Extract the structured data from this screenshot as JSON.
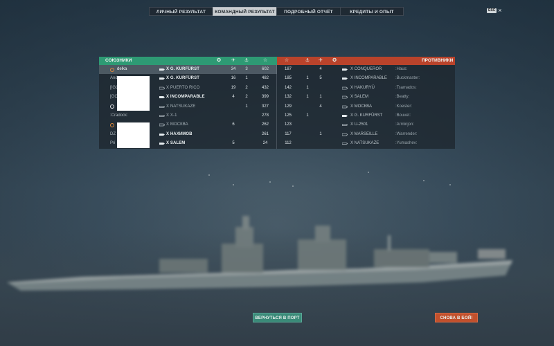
{
  "tabs": [
    {
      "label": "ЛИЧНЫЙ РЕЗУЛЬТАТ",
      "active": false
    },
    {
      "label": "КОМАНДНЫЙ РЕЗУЛЬТАТ",
      "active": true
    },
    {
      "label": "ПОДРОБНЫЙ ОТЧЁТ",
      "active": false
    },
    {
      "label": "КРЕДИТЫ И ОПЫТ",
      "active": false
    }
  ],
  "esc": {
    "key": "ESC",
    "close": "×"
  },
  "allies": {
    "title": "СОЮЗНИКИ",
    "color": "#2e9a74",
    "column_icons": [
      "laurel-icon",
      "planes-icon",
      "ship-kill-icon",
      "star-icon"
    ],
    "rows": [
      {
        "name": "delka",
        "ship": "X G. KURFÜRST",
        "c1": "",
        "c2": "34",
        "c3": "3",
        "score": "602",
        "selected": true
      },
      {
        "name": "And",
        "ship": "X G. KURFÜRST",
        "c1": "",
        "c2": "16",
        "c3": "1",
        "score": "482"
      },
      {
        "name": "[IGO",
        "ship": "X PUERTO RICO",
        "c1": "",
        "c2": "19",
        "c3": "2",
        "score": "432"
      },
      {
        "name": "[GC",
        "ship": "X INCOMPARABLE",
        "c1": "",
        "c2": "4",
        "c3": "2",
        "score": "399"
      },
      {
        "name": "",
        "ship": "X NATSUKAZE",
        "c1": "",
        "c2": "",
        "c3": "1",
        "score": "327"
      },
      {
        "name": ":Cradock:",
        "ship": "X X-1",
        "c1": "",
        "c2": "",
        "c3": "",
        "score": "278"
      },
      {
        "name": "",
        "ship": "X МОСКВА",
        "c1": "",
        "c2": "6",
        "c3": "",
        "score": "262"
      },
      {
        "name": "DZ",
        "ship": "X НАХИМОВ",
        "c1": "",
        "c2": "",
        "c3": "",
        "score": "261"
      },
      {
        "name": "Pri",
        "ship": "X SALEM",
        "c1": "",
        "c2": "5",
        "c3": "",
        "score": "24"
      }
    ]
  },
  "enemies": {
    "title": "ПРОТИВНИКИ",
    "color": "#b9432b",
    "column_icons": [
      "star-icon",
      "ship-kill-icon",
      "planes-icon",
      "laurel-icon"
    ],
    "rows": [
      {
        "score": "187",
        "c1": "",
        "c2": "4",
        "c3": "",
        "ship": "X CONQUEROR",
        "name": ":Haus:"
      },
      {
        "score": "185",
        "c1": "1",
        "c2": "5",
        "c3": "",
        "ship": "X INCOMPARABLE",
        "name": ":Buckmaster:"
      },
      {
        "score": "142",
        "c1": "1",
        "c2": "",
        "c3": "",
        "ship": "X HAKURYŪ",
        "name": ":Tsamados:"
      },
      {
        "score": "132",
        "c1": "1",
        "c2": "1",
        "c3": "",
        "ship": "X SALEM",
        "name": ":Beatty:"
      },
      {
        "score": "129",
        "c1": "",
        "c2": "4",
        "c3": "",
        "ship": "X МОСКВА",
        "name": ":Koester:"
      },
      {
        "score": "125",
        "c1": "1",
        "c2": "",
        "c3": "",
        "ship": "X G. KURFÜRST",
        "name": ":Bouvet:"
      },
      {
        "score": "123",
        "c1": "",
        "c2": "",
        "c3": "",
        "ship": "X U-2501",
        "name": ":Arminjon:"
      },
      {
        "score": "117",
        "c1": "",
        "c2": "1",
        "c3": "",
        "ship": "X MARSEILLE",
        "name": ":Warrender:"
      },
      {
        "score": "112",
        "c1": "",
        "c2": "",
        "c3": "",
        "ship": "X NATSUKAZE",
        "name": ":Yumashev:"
      }
    ]
  },
  "buttons": {
    "port": "ВЕРНУТЬСЯ В ПОРТ",
    "battle": "СНОВА В БОЙ!"
  }
}
